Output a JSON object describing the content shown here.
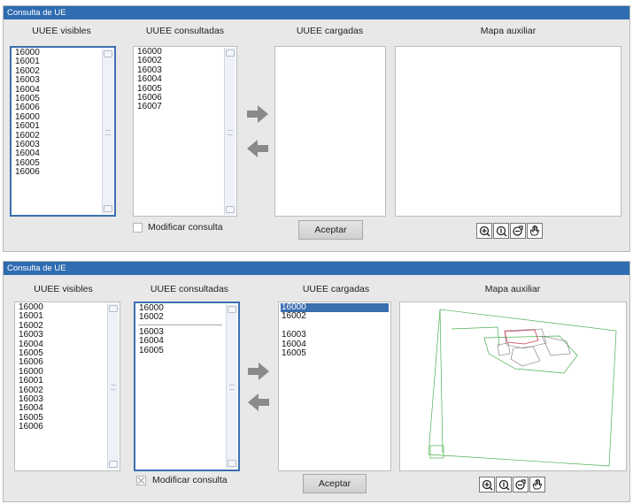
{
  "panels": [
    {
      "title": "Consulta de UE",
      "headers": {
        "visibles": "UUEE visibles",
        "consultadas": "UUEE consultadas",
        "cargadas": "UUEE cargadas",
        "mapa": "Mapa auxiliar"
      },
      "visibles": [
        "16000",
        "16001",
        "16002",
        "16003",
        "16004",
        "16005",
        "16006",
        "16000",
        "16001",
        "16002",
        "16003",
        "16004",
        "16005",
        "16006"
      ],
      "consultadas": [
        "16000",
        "16002",
        "16003",
        "16004",
        "16005",
        "16006",
        "16007"
      ],
      "cargadas": [],
      "checkbox_label": "Modificar consulta",
      "accept_label": "Aceptar"
    },
    {
      "title": "Consulta de UE",
      "headers": {
        "visibles": "UUEE visibles",
        "consultadas": "UUEE consultadas",
        "cargadas": "UUEE cargadas",
        "mapa": "Mapa auxiliar"
      },
      "visibles": [
        "16000",
        "16001",
        "16002",
        "16003",
        "16004",
        "16005",
        "16006",
        "16000",
        "16001",
        "16002",
        "16003",
        "16004",
        "16005",
        "16006"
      ],
      "consultadas": [
        "16000",
        "16002",
        "",
        "16003",
        "16004",
        "16005"
      ],
      "cargadas": [
        "16000",
        "16002",
        "",
        "16003",
        "16004",
        "16005"
      ],
      "cargadas_selected": "16000",
      "checkbox_label": "Modificar consulta",
      "accept_label": "Aceptar"
    }
  ],
  "colors": {
    "title_bar": "#2f6cb1",
    "focus_border": "#3b6fb0",
    "arrow": "#8a8a8a",
    "map_lines": "#4caf50"
  },
  "icons": {
    "move_right": "arrow-right-icon",
    "move_left": "arrow-left-icon",
    "tools": [
      "zoom-in-icon",
      "zoom-out-icon",
      "zoom-extent-icon",
      "pan-hand-icon"
    ]
  }
}
